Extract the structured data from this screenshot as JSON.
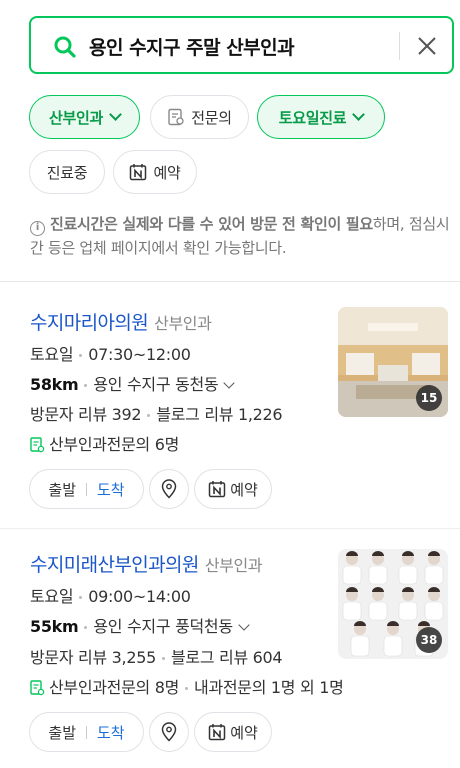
{
  "search": {
    "query": "용인 수지구 주말 산부인과"
  },
  "filters": [
    {
      "label": "산부인과",
      "active": true,
      "icon": "chevron-down-icon"
    },
    {
      "label": "전문의",
      "active": false,
      "icon": "specialist-icon"
    },
    {
      "label": "토요일진료",
      "active": true,
      "icon": "chevron-down-icon"
    },
    {
      "label": "진료중",
      "active": false
    },
    {
      "label": "예약",
      "active": false,
      "icon": "naver-reservation-icon"
    }
  ],
  "notice": {
    "bold_part": "진료시간은 실제와 다를 수 있어 방문 전 확인이 필요",
    "rest": "하며, 점심시간 등은 업체 페이지에서 확인 가능합니다."
  },
  "results": [
    {
      "name": "수지마리아의원",
      "category": "산부인과",
      "day": "토요일",
      "hours": "07:30~12:00",
      "distance": "58km",
      "address": "용인 수지구 동천동",
      "visitor_reviews": "방문자 리뷰 392",
      "blog_reviews": "블로그 리뷰 1,226",
      "specialists": "산부인과전문의 6명",
      "specialists_extra": "",
      "photo_count": "15",
      "actions": {
        "depart": "출발",
        "arrive": "도착",
        "reserve": "예약"
      }
    },
    {
      "name": "수지미래산부인과의원",
      "category": "산부인과",
      "day": "토요일",
      "hours": "09:00~14:00",
      "distance": "55km",
      "address": "용인 수지구 풍덕천동",
      "visitor_reviews": "방문자 리뷰 3,255",
      "blog_reviews": "블로그 리뷰 604",
      "specialists": "산부인과전문의 8명",
      "specialists_extra": "내과전문의 1명 외 1명",
      "photo_count": "38",
      "actions": {
        "depart": "출발",
        "arrive": "도착",
        "reserve": "예약"
      }
    }
  ],
  "colors": {
    "accent_green": "#03c75a",
    "link_blue": "#1a56c9"
  }
}
